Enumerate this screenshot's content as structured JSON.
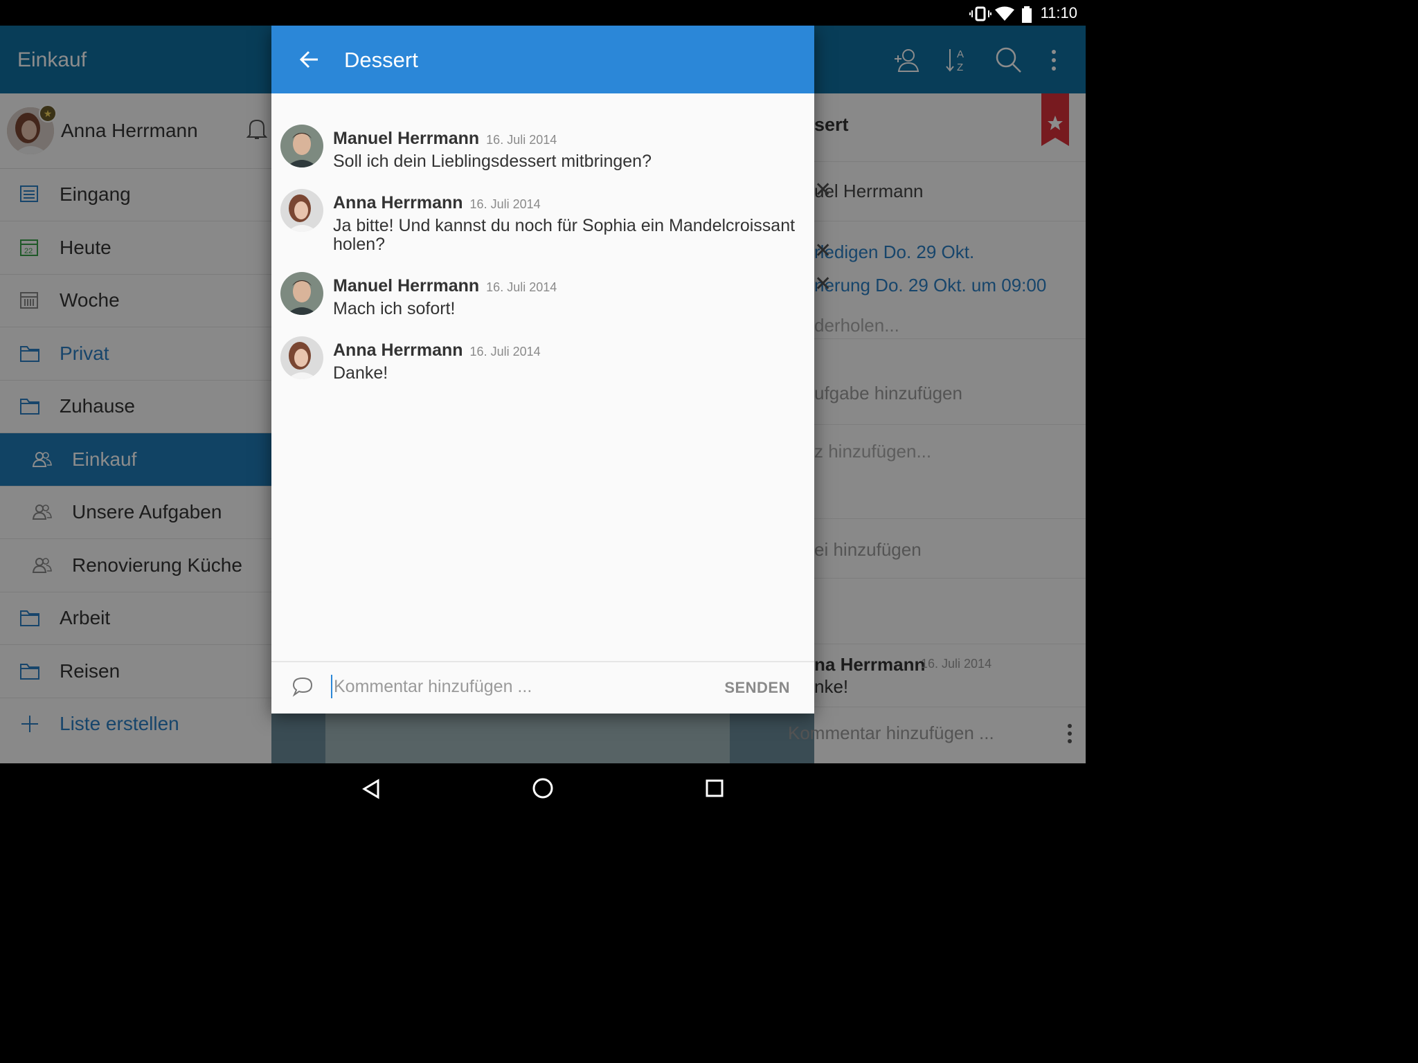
{
  "status_bar": {
    "time": "11:10"
  },
  "app": {
    "title": "Einkauf",
    "toolbar_icons": [
      "add-person-icon",
      "sort-az-icon",
      "search-icon",
      "more-vert-icon"
    ]
  },
  "sidebar": {
    "user_name": "Anna Herrmann",
    "items": [
      {
        "label": "Eingang",
        "icon": "inbox-icon"
      },
      {
        "label": "Heute",
        "icon": "calendar-today-icon",
        "day": "22"
      },
      {
        "label": "Woche",
        "icon": "calendar-week-icon"
      },
      {
        "label": "Privat",
        "icon": "folder-icon"
      },
      {
        "label": "Zuhause",
        "icon": "folder-icon"
      },
      {
        "label": "Einkauf",
        "icon": "shared-list-icon"
      },
      {
        "label": "Unsere Aufgaben",
        "icon": "shared-list-icon"
      },
      {
        "label": "Renovierung Küche",
        "icon": "shared-list-icon"
      },
      {
        "label": "Arbeit",
        "icon": "folder-icon"
      },
      {
        "label": "Reisen",
        "icon": "folder-icon"
      },
      {
        "label": "Liste erstellen",
        "icon": "plus-icon"
      }
    ]
  },
  "detail": {
    "title_fragment": "sert",
    "assignee_fragment": "uel Herrmann",
    "due_fragment": "rledigen Do. 29 Okt.",
    "reminder_fragment": "nerung Do. 29 Okt. um 09:00",
    "repeat_fragment": "derholen...",
    "subtask_fragment": "ufgabe hinzufügen",
    "note_fragment": "z hinzufügen...",
    "file_fragment": "ei hinzufügen",
    "comment_author_fragment": "na Herrmann",
    "comment_date": "16. Juli 2014",
    "comment_text_fragment": "nke!",
    "comment_placeholder_fragment": "Kommentar hinzufügen ..."
  },
  "dialog": {
    "title": "Dessert",
    "messages": [
      {
        "author": "Manuel Herrmann",
        "date": "16. Juli 2014",
        "text": "Soll ich dein Lieblingsdessert mitbringen?"
      },
      {
        "author": "Anna Herrmann",
        "date": "16. Juli 2014",
        "text": "Ja bitte! Und kannst du noch für Sophia ein Mandelcroissant holen?"
      },
      {
        "author": "Manuel Herrmann",
        "date": "16. Juli 2014",
        "text": "Mach ich sofort!"
      },
      {
        "author": "Anna Herrmann",
        "date": "16. Juli 2014",
        "text": "Danke!"
      }
    ],
    "composer": {
      "placeholder": "Kommentar hinzufügen ...",
      "send_label": "SENDEN"
    }
  },
  "colors": {
    "app_bar": "#106fa0",
    "dialog_header": "#2b87d8",
    "active_item": "#1f7bb6",
    "link_blue": "#2b7fc3",
    "star_ribbon": "#d9303a"
  }
}
